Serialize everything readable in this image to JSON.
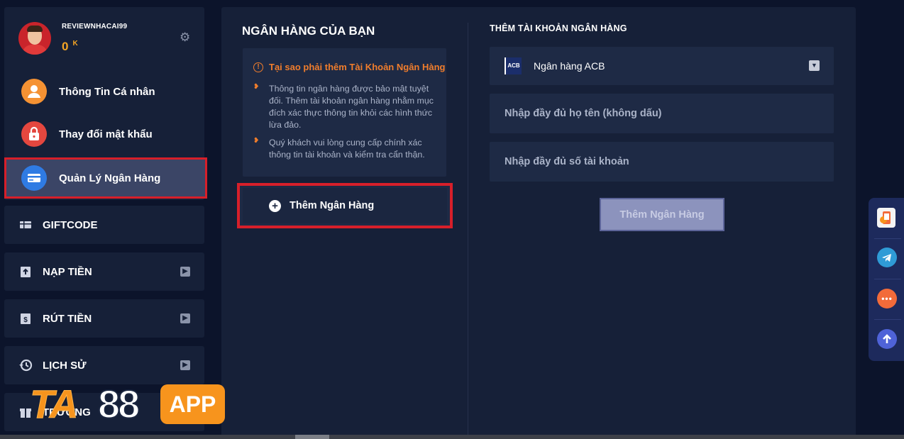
{
  "profile": {
    "username": "REVIEWNHACAI99",
    "balance": "0",
    "balance_unit": "K"
  },
  "sidebar": {
    "items": [
      {
        "label": "Thông Tin Cá nhân"
      },
      {
        "label": "Thay đổi mật khẩu"
      },
      {
        "label": "Quản Lý Ngân Hàng"
      }
    ],
    "nav": [
      {
        "label": "GIFTCODE"
      },
      {
        "label": "NẠP TIỀN"
      },
      {
        "label": "RÚT TIỀN"
      },
      {
        "label": "LỊCH SỬ"
      },
      {
        "label": "TRƯỚNG"
      }
    ]
  },
  "your_banks": {
    "title": "NGÂN HÀNG CỦA BẠN",
    "info_heading": "Tại sao phải thêm Tài Khoản Ngân Hàng",
    "bullets": [
      "Thông tin ngân hàng được bảo mật tuyệt đối. Thêm tài khoản ngân hàng nhằm mục đích xác thực thông tin khỏi các hình thức lừa đảo.",
      "Quý khách vui lòng cung cấp chính xác thông tin tài khoản và kiểm tra cẩn thận."
    ],
    "add_button": "Thêm Ngân Hàng"
  },
  "add_account": {
    "title": "THÊM TÀI KHOẢN NGÂN HÀNG",
    "bank_logo_text": "ACB",
    "selected_bank": "Ngân hàng ACB",
    "name_placeholder": "Nhập đầy đủ họ tên (không dấu)",
    "account_placeholder": "Nhập đầy đủ số tài khoản",
    "submit": "Thêm Ngân Hàng"
  },
  "watermark": {
    "brand_a": "TA",
    "brand_b": "88",
    "brand_c": "APP"
  },
  "colors": {
    "accent_orange": "#f07d2c",
    "highlight_red": "#d71f2a",
    "panel": "#162038",
    "background": "#0c142b"
  }
}
